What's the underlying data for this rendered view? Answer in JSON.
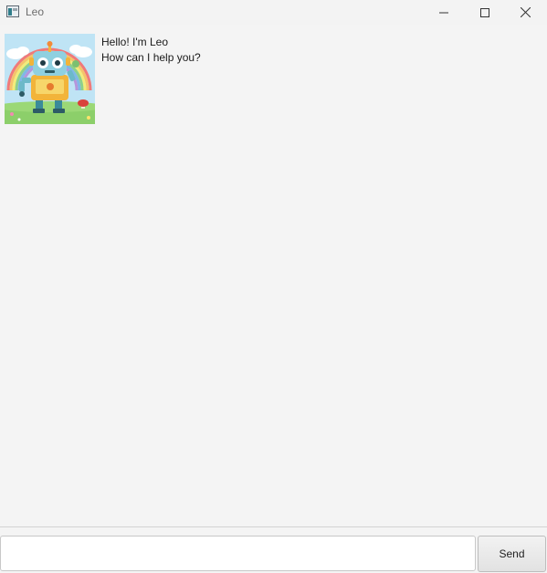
{
  "window": {
    "title": "Leo",
    "icon": "java-app-icon",
    "controls": [
      "minimize-icon",
      "maximize-icon",
      "close-icon"
    ]
  },
  "dialog": {
    "messages": [
      {
        "sender": "Leo",
        "avatar": "robot-avatar-image",
        "lines": [
          "Hello! I'm Leo",
          "How can I help you?"
        ]
      }
    ]
  },
  "input": {
    "value": "",
    "placeholder": ""
  },
  "send_button": {
    "label": "Send"
  }
}
